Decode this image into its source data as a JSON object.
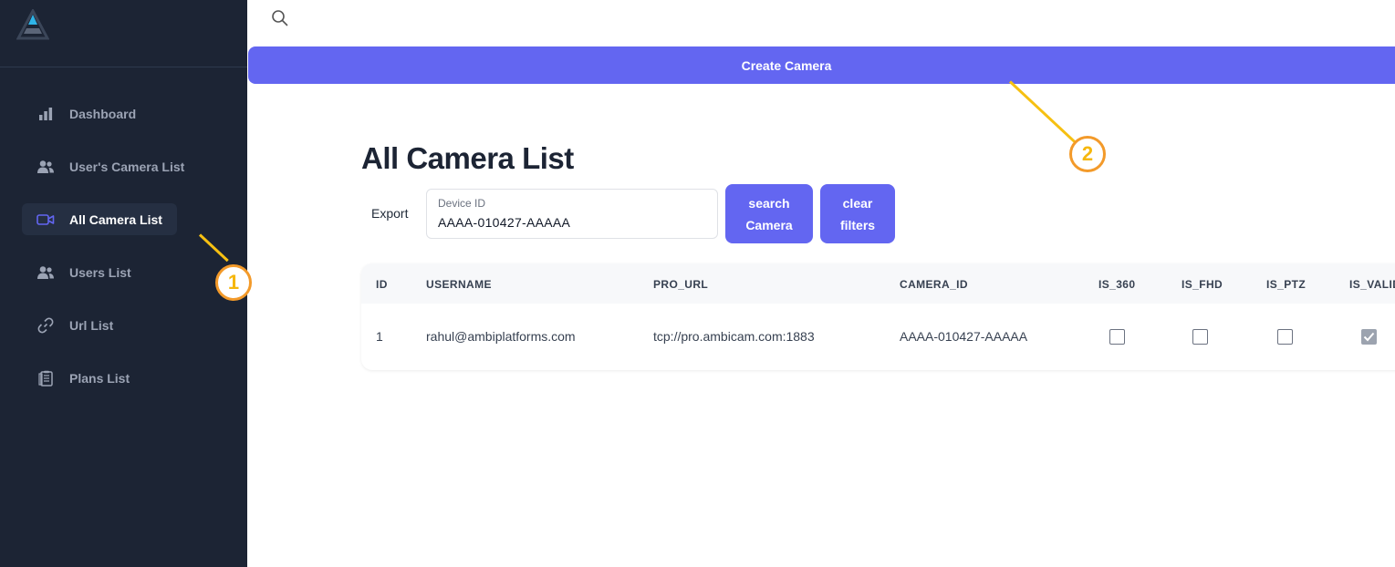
{
  "sidebar": {
    "items": [
      {
        "label": "Dashboard",
        "icon": "bar-chart-icon"
      },
      {
        "label": "User's Camera List",
        "icon": "users-icon"
      },
      {
        "label": "All Camera List",
        "icon": "video-camera-icon",
        "active": true
      },
      {
        "label": "Users List",
        "icon": "users-icon"
      },
      {
        "label": "Url List",
        "icon": "link-icon"
      },
      {
        "label": "Plans List",
        "icon": "clipboard-icon"
      }
    ]
  },
  "header": {
    "create_button": "Create Camera"
  },
  "main": {
    "title": "All Camera List",
    "export_label": "Export",
    "device_field": {
      "label": "Device ID",
      "value": "AAAA-010427-AAAAA"
    },
    "search_button": "search Camera",
    "clear_button": "clear filters"
  },
  "table": {
    "columns": [
      "ID",
      "USERNAME",
      "PRO_URL",
      "CAMERA_ID",
      "IS_360",
      "IS_FHD",
      "IS_PTZ",
      "IS_VALID"
    ],
    "rows": [
      {
        "id": "1",
        "username": "rahul@ambiplatforms.com",
        "pro_url": "tcp://pro.ambicam.com:1883",
        "camera_id": "AAAA-010427-AAAAA",
        "is_360": false,
        "is_fhd": false,
        "is_ptz": false,
        "is_valid": true
      }
    ]
  },
  "annotations": [
    "1",
    "2"
  ],
  "colors": {
    "sidebar_bg": "#1c2434",
    "accent": "#6366f1",
    "annotation": "#f39a2a"
  }
}
